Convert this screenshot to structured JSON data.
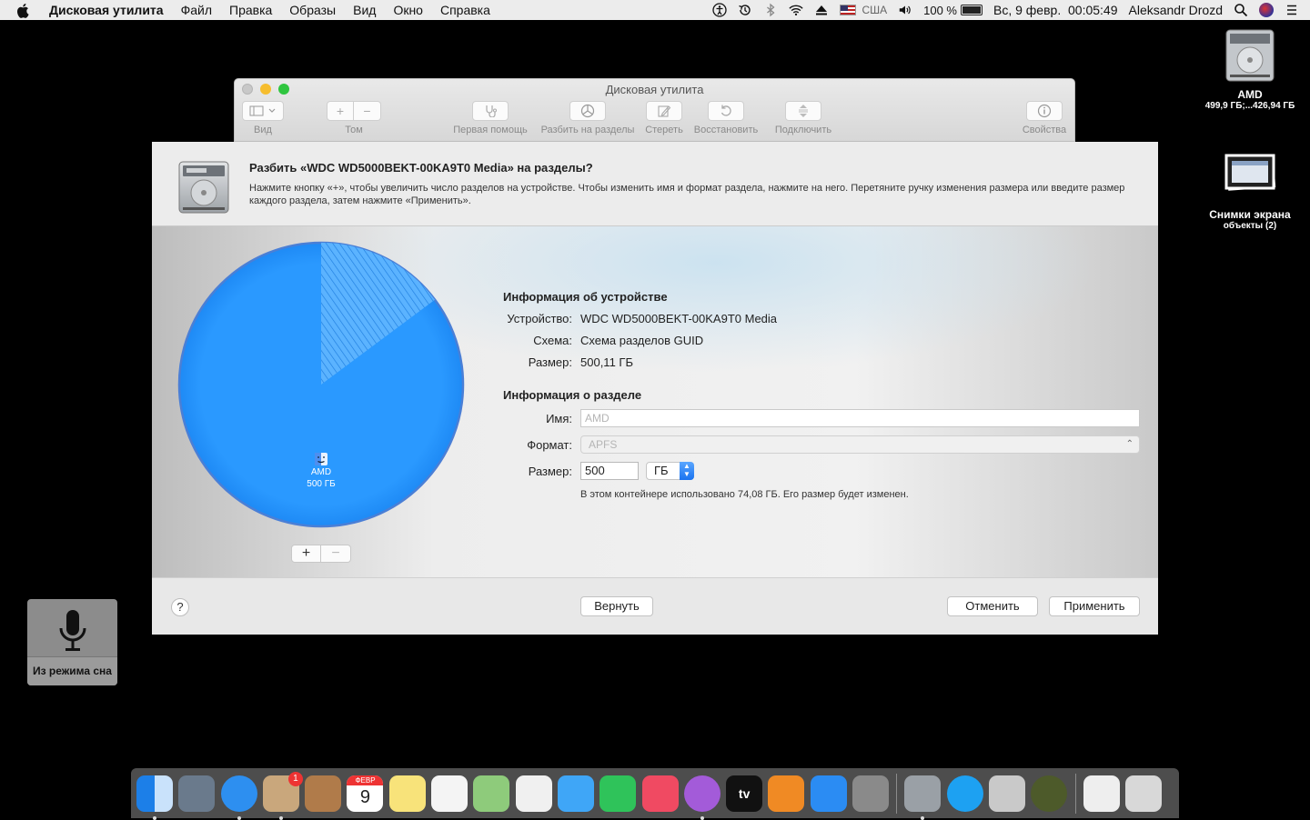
{
  "menubar": {
    "app_name": "Дисковая утилита",
    "items": [
      "Файл",
      "Правка",
      "Образы",
      "Вид",
      "Окно",
      "Справка"
    ],
    "input_source": "США",
    "battery": "100 %",
    "datetime": "Вс, 9 февр.  00:05:49",
    "user": "Aleksandr Drozd"
  },
  "window": {
    "title": "Дисковая утилита",
    "toolbar": {
      "view": "Вид",
      "volume": "Том",
      "first_aid": "Первая помощь",
      "partition": "Разбить на разделы",
      "erase": "Стереть",
      "restore": "Восстановить",
      "mount": "Подключить",
      "info": "Свойства"
    }
  },
  "sheet": {
    "title": "Разбить «WDC WD5000BEKT-00KA9T0 Media» на разделы?",
    "description": "Нажмите кнопку «+», чтобы увеличить число разделов на устройстве. Чтобы изменить имя и формат раздела, нажмите на него. Перетяните ручку изменения размера или введите размер каждого раздела, затем нажмите «Применить».",
    "pie": {
      "partition_name": "AMD",
      "partition_size": "500 ГБ",
      "used_fraction": 0.148,
      "color": "#1e96ff"
    },
    "device_info": {
      "heading": "Информация об устройстве",
      "device_label": "Устройство:",
      "device_value": "WDC WD5000BEKT-00KA9T0 Media",
      "scheme_label": "Схема:",
      "scheme_value": "Схема разделов GUID",
      "size_label": "Размер:",
      "size_value": "500,11 ГБ"
    },
    "partition_info": {
      "heading": "Информация о разделе",
      "name_label": "Имя:",
      "name_placeholder": "AMD",
      "format_label": "Формат:",
      "format_value": "APFS",
      "size_label": "Размер:",
      "size_value": "500",
      "unit": "ГБ",
      "note": "В этом контейнере использовано 74,08 ГБ. Его размер будет изменен."
    },
    "buttons": {
      "help": "?",
      "revert": "Вернуть",
      "cancel": "Отменить",
      "apply": "Применить"
    }
  },
  "desktop": {
    "drive": {
      "name": "AMD",
      "detail": "499,9 ГБ;...426,94 ГБ"
    },
    "folder": {
      "name": "Снимки экрана",
      "detail": "объекты (2)"
    }
  },
  "dictation": {
    "label": "Из режима сна"
  },
  "dock": {
    "calendar_month": "ФЕВР",
    "calendar_day": "9",
    "mail_badge": "1",
    "tv_label": "tv",
    "apps": [
      {
        "name": "Finder",
        "color": "#3ba0f5",
        "running": true
      },
      {
        "name": "Launchpad",
        "color": "#6a7a8c",
        "running": false
      },
      {
        "name": "Safari",
        "color": "#2d8ff0",
        "running": true
      },
      {
        "name": "Mail",
        "color": "#c9a77c",
        "running": true
      },
      {
        "name": "Contacts",
        "color": "#b07b4a",
        "running": false
      },
      {
        "name": "Calendar",
        "color": "#ffffff",
        "running": false
      },
      {
        "name": "Notes",
        "color": "#f8e37a",
        "running": false
      },
      {
        "name": "Reminders",
        "color": "#f4f4f4",
        "running": false
      },
      {
        "name": "Maps",
        "color": "#8ecb7b",
        "running": false
      },
      {
        "name": "Photos",
        "color": "#f0f0f0",
        "running": false
      },
      {
        "name": "Messages",
        "color": "#3fa6f7",
        "running": false
      },
      {
        "name": "FaceTime",
        "color": "#2fc35a",
        "running": false
      },
      {
        "name": "Music",
        "color": "#f04a62",
        "running": false
      },
      {
        "name": "Podcasts",
        "color": "#a35bd9",
        "running": true
      },
      {
        "name": "TV",
        "color": "#111111",
        "running": false
      },
      {
        "name": "Books",
        "color": "#f08a24",
        "running": false
      },
      {
        "name": "App Store",
        "color": "#2b8cf3",
        "running": false
      },
      {
        "name": "System Preferences",
        "color": "#8a8a8a",
        "running": false
      },
      {
        "name": "Disk Utility",
        "color": "#9aa0a6",
        "running": true
      },
      {
        "name": "Twitter",
        "color": "#1da1f2",
        "running": false
      },
      {
        "name": "Directory Utility",
        "color": "#c9c9c9",
        "running": false
      },
      {
        "name": "Radar",
        "color": "#4d5a2a",
        "running": false
      },
      {
        "name": "Document",
        "color": "#eeeeee",
        "running": false
      },
      {
        "name": "Trash",
        "color": "#d8d8d8",
        "running": false
      }
    ]
  }
}
